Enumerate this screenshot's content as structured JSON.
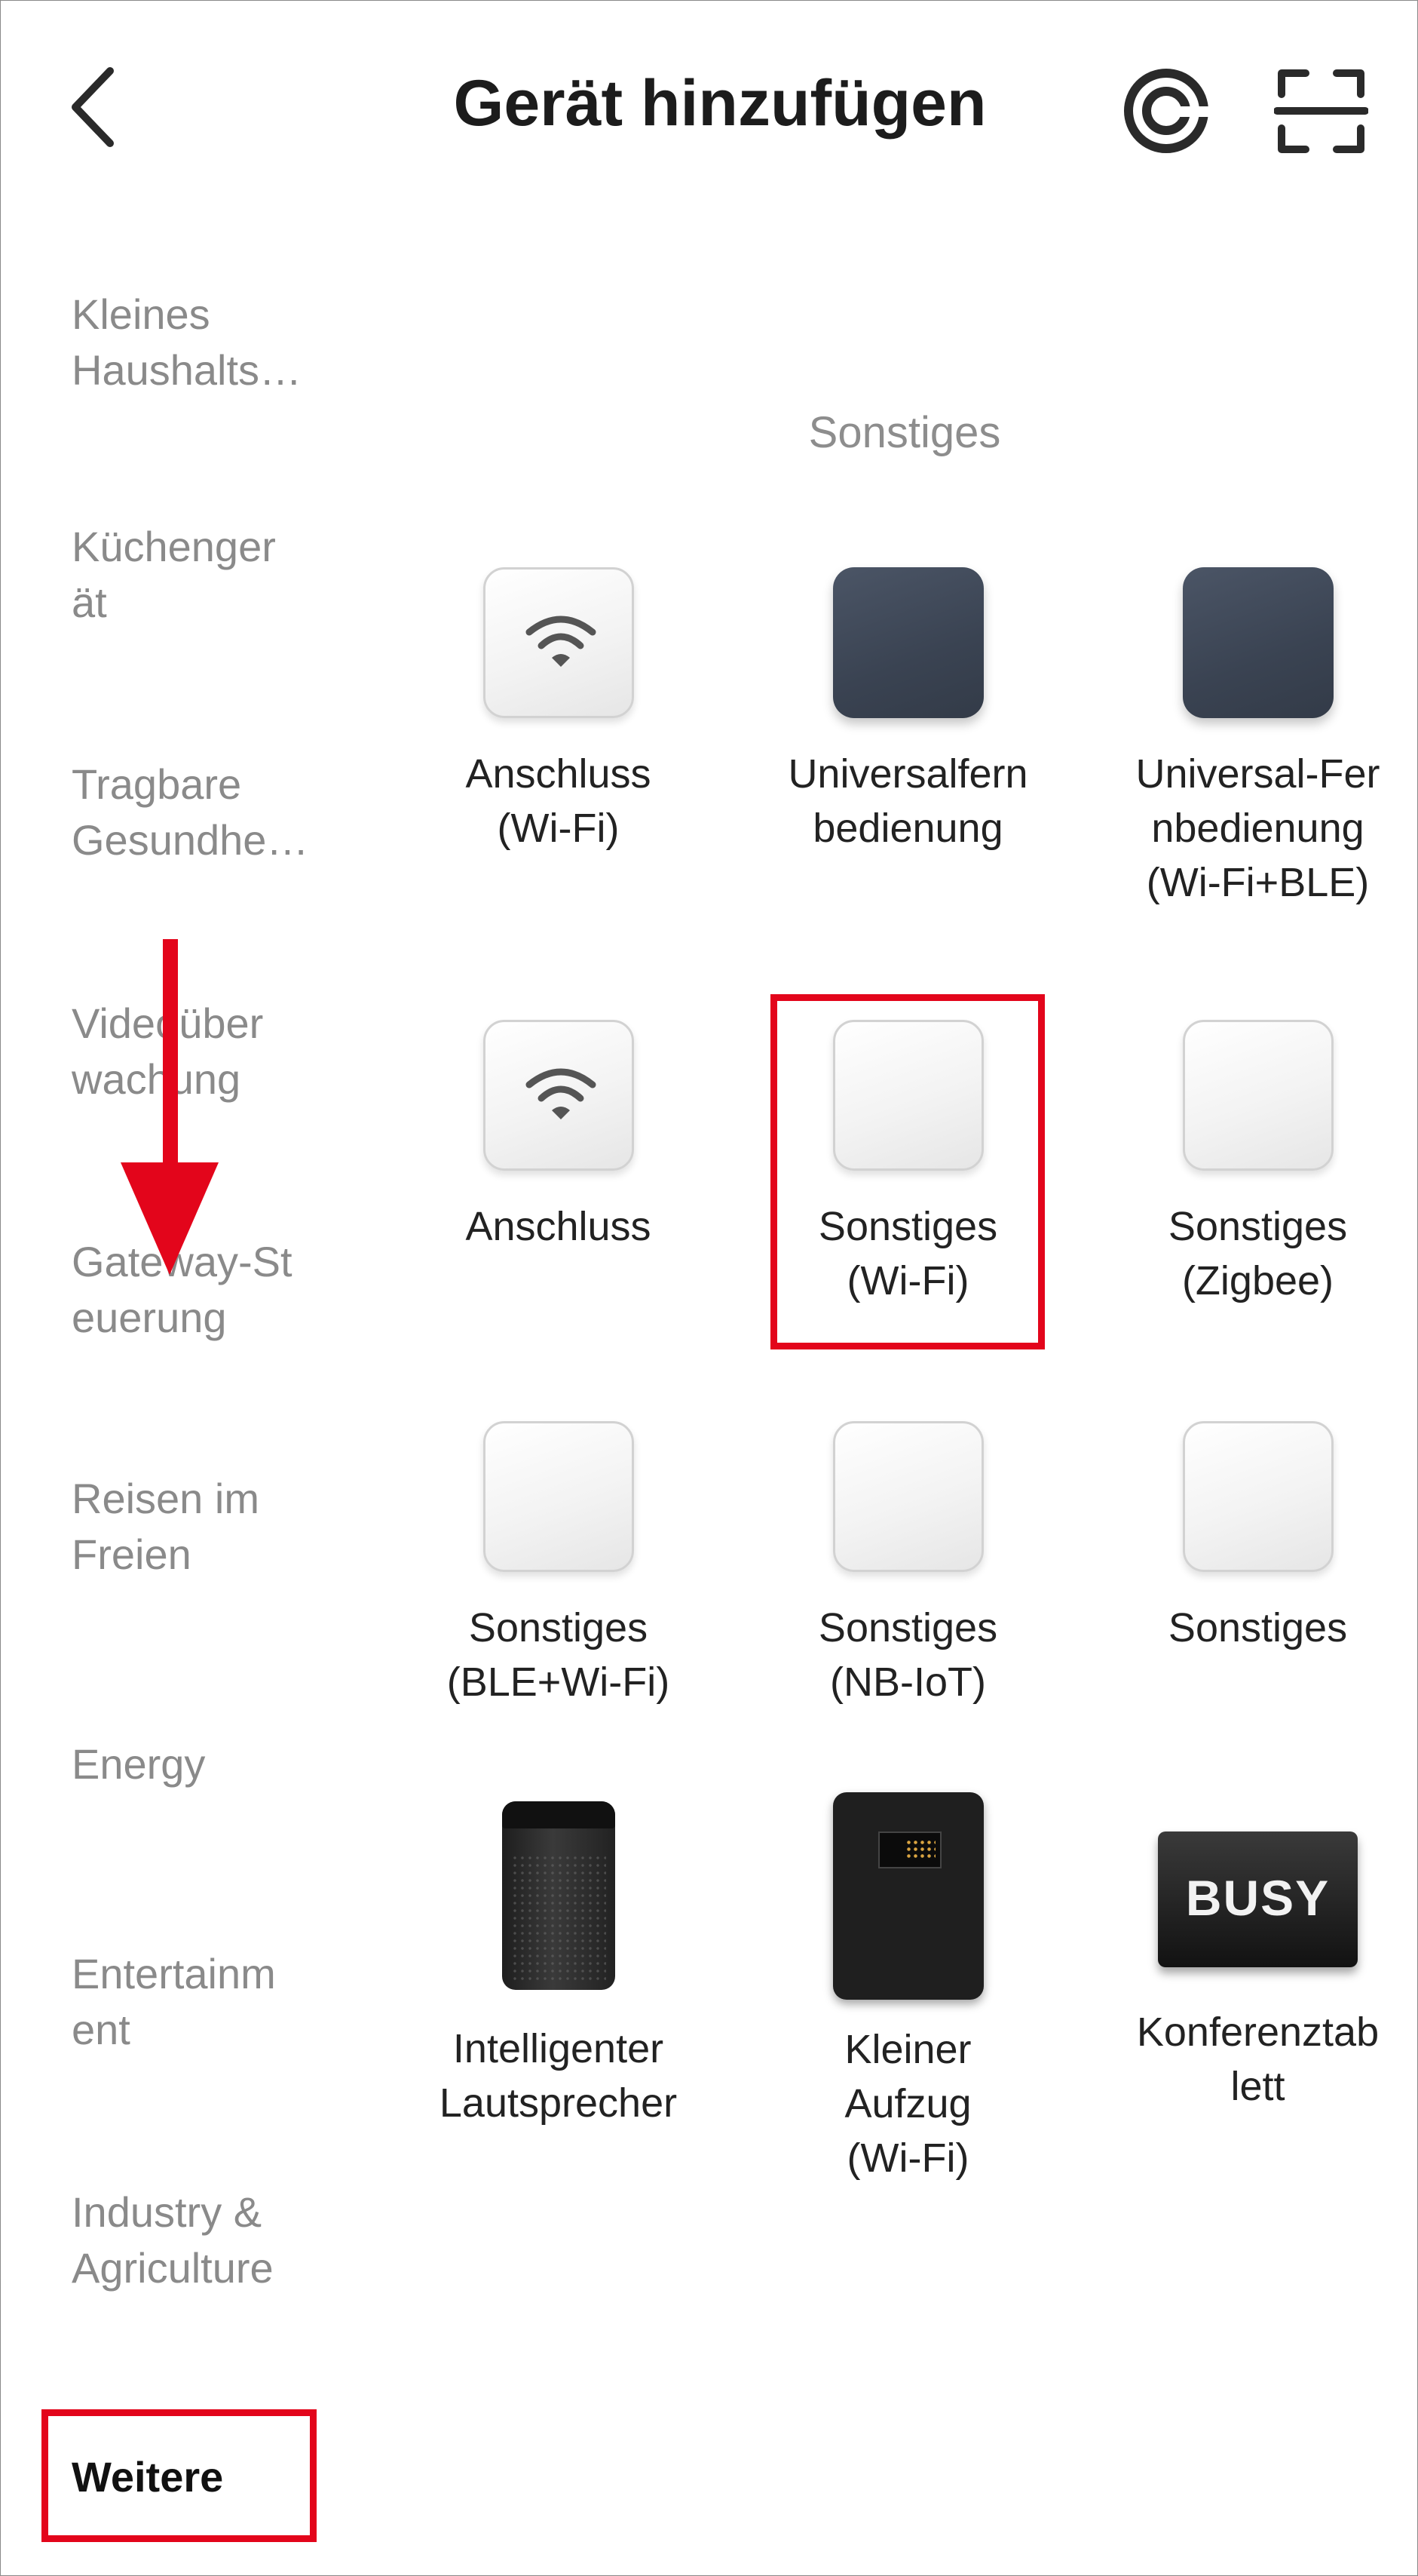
{
  "header": {
    "title": "Gerät hinzufügen"
  },
  "sidebar": {
    "items": [
      {
        "label": "Kleines\nHaushalts…"
      },
      {
        "label": "Küchenger\nät"
      },
      {
        "label": "Tragbare\nGesundhe…"
      },
      {
        "label": "Videoüber\nwachung"
      },
      {
        "label": "Gateway-St\neuerung"
      },
      {
        "label": "Reisen im\nFreien"
      },
      {
        "label": "Energy"
      },
      {
        "label": "Entertainm\nent"
      },
      {
        "label": "Industry &\nAgriculture"
      },
      {
        "label": "Weitere"
      }
    ]
  },
  "section": {
    "title": "Sonstiges"
  },
  "devices": [
    {
      "label": "Anschluss\n(Wi-Fi)",
      "icon": "wifi-plug-icon"
    },
    {
      "label": "Universalfern\nbedienung",
      "icon": "remote-hub-icon"
    },
    {
      "label": "Universal-Fer\nnbedienung\n(Wi-Fi+BLE)",
      "icon": "remote-hub-icon"
    },
    {
      "label": "Anschluss",
      "icon": "wifi-plug-icon"
    },
    {
      "label": "Sonstiges\n(Wi-Fi)",
      "icon": "generic-device-icon"
    },
    {
      "label": "Sonstiges\n(Zigbee)",
      "icon": "generic-device-icon"
    },
    {
      "label": "Sonstiges\n(BLE+Wi-Fi)",
      "icon": "generic-device-icon"
    },
    {
      "label": "Sonstiges\n(NB-IoT)",
      "icon": "generic-device-icon"
    },
    {
      "label": "Sonstiges",
      "icon": "generic-device-icon"
    },
    {
      "label": "Intelligenter\nLautsprecher",
      "icon": "smart-speaker-icon"
    },
    {
      "label": "Kleiner\nAufzug\n(Wi-Fi)",
      "icon": "elevator-icon"
    },
    {
      "label": "Konferenztab\nlett",
      "icon": "conference-tablet-icon",
      "icon_text": "BUSY"
    }
  ],
  "colors": {
    "highlight": "#e3051b",
    "muted_text": "#8a8a8a",
    "hub_dark": "#3a4352"
  }
}
